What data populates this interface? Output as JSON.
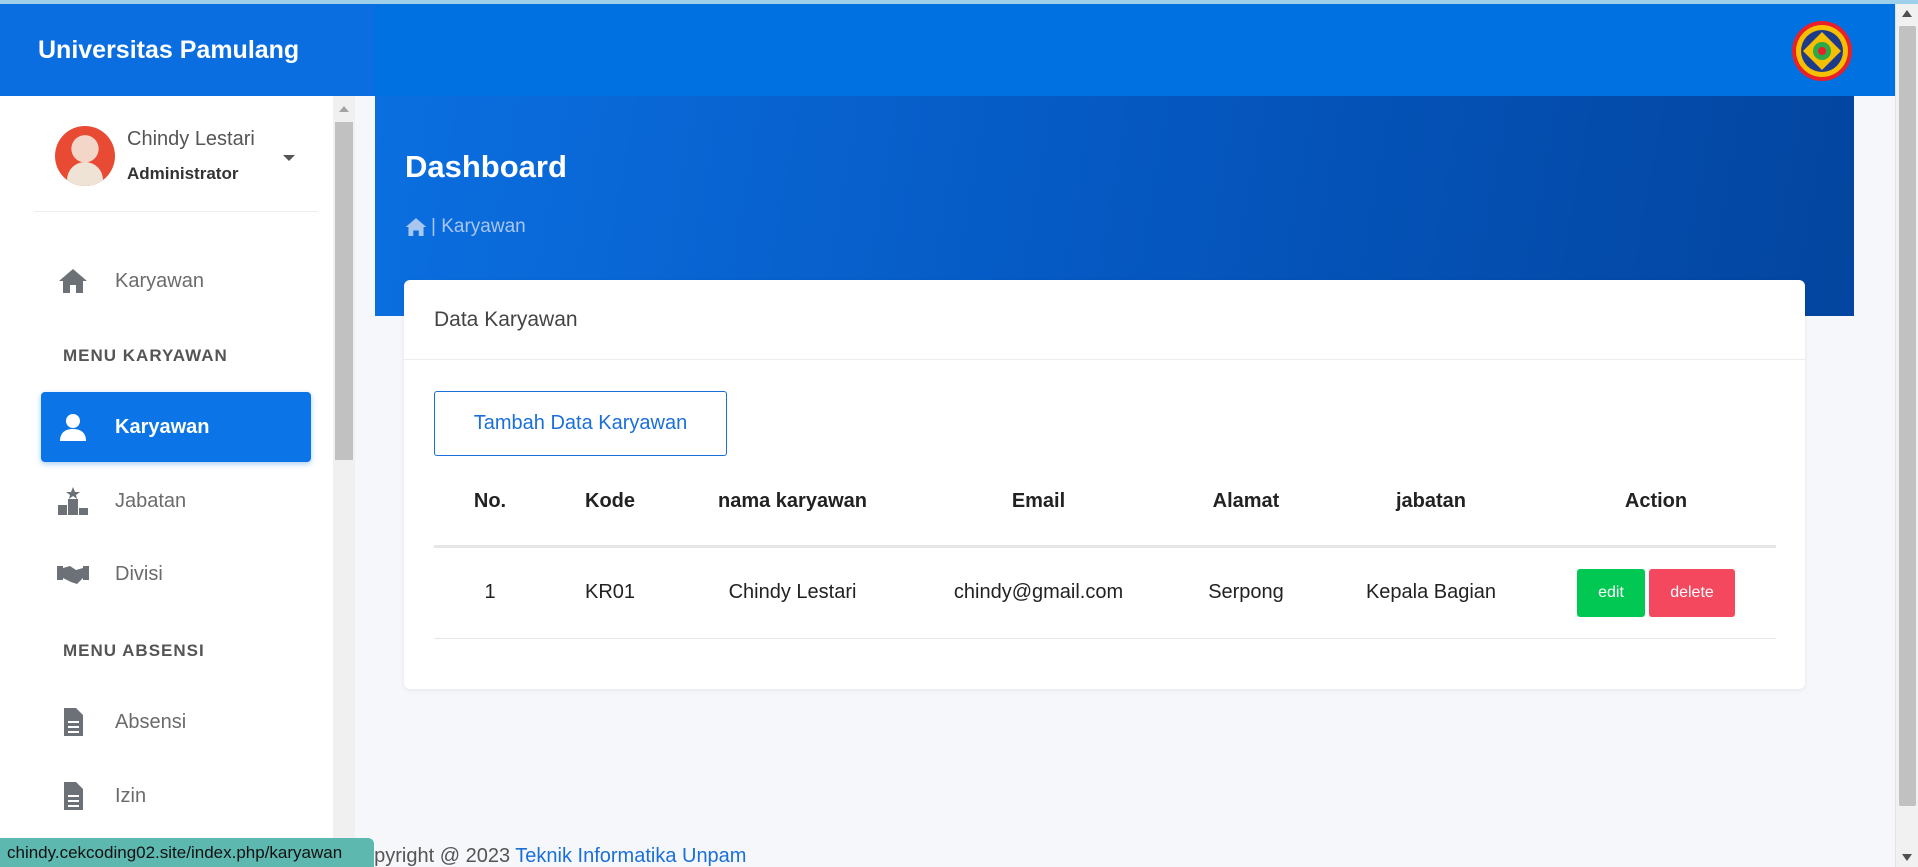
{
  "brand": {
    "title": "Universitas Pamulang"
  },
  "user": {
    "name": "Chindy Lestari",
    "role": "Administrator"
  },
  "sidebar": {
    "top_item": {
      "label": "Karyawan",
      "icon": "home-icon"
    },
    "section1": "MENU KARYAWAN",
    "menu_karyawan": [
      {
        "label": "Karyawan",
        "icon": "user-icon",
        "active": true
      },
      {
        "label": "Jabatan",
        "icon": "podium-icon",
        "active": false
      },
      {
        "label": "Divisi",
        "icon": "handshake-icon",
        "active": false
      }
    ],
    "section2": "MENU ABSENSI",
    "menu_absensi": [
      {
        "label": "Absensi",
        "icon": "file-icon"
      },
      {
        "label": "Izin",
        "icon": "file-icon"
      }
    ]
  },
  "hero": {
    "title": "Dashboard",
    "breadcrumb": "| Karyawan"
  },
  "card": {
    "title": "Data Karyawan",
    "add_button": "Tambah Data Karyawan",
    "columns": [
      "No.",
      "Kode",
      "nama karyawan",
      "Email",
      "Alamat",
      "jabatan",
      "Action"
    ],
    "rows": [
      {
        "no": "1",
        "kode": "KR01",
        "nama": "Chindy Lestari",
        "email": "chindy@gmail.com",
        "alamat": "Serpong",
        "jabatan": "Kepala Bagian",
        "edit": "edit",
        "delete": "delete"
      }
    ]
  },
  "footer": {
    "text": "opyright @ 2023",
    "link": "Teknik Informatika Unpam"
  },
  "status_url": "chindy.cekcoding02.site/index.php/karyawan",
  "colors": {
    "primary": "#0071e1",
    "edit": "#00c853",
    "delete": "#f3485e"
  }
}
